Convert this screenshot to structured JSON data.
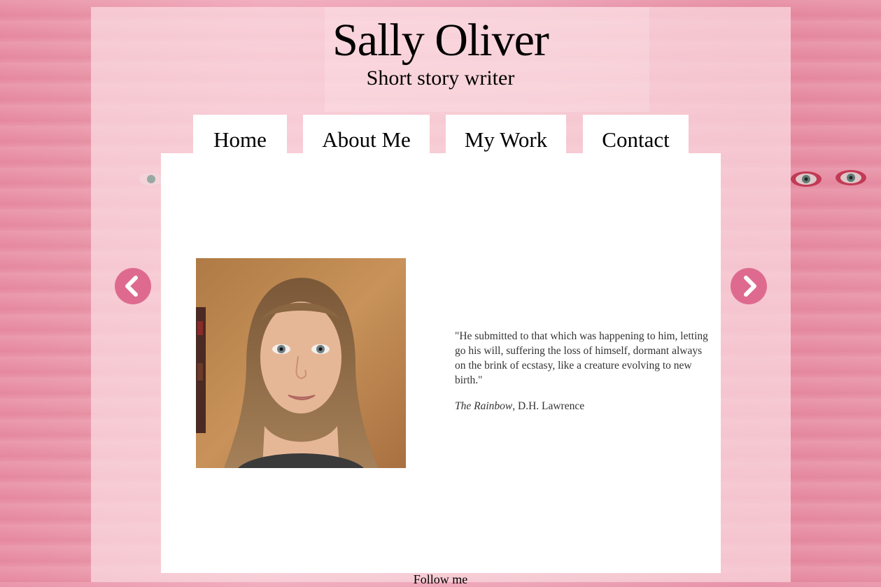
{
  "header": {
    "title": "Sally Oliver",
    "subtitle": "Short story writer"
  },
  "nav": {
    "tabs": [
      {
        "label": "Home"
      },
      {
        "label": "About Me"
      },
      {
        "label": "My Work"
      },
      {
        "label": "Contact"
      }
    ]
  },
  "slider": {
    "prev_icon": "chevron-left-icon",
    "next_icon": "chevron-right-icon",
    "accent_color": "#de6b8f"
  },
  "slide": {
    "image_alt": "Portrait photo",
    "quote": "\"He submitted to that which was happening to him, letting go his will, suffering the loss of himself, dormant always on the brink of ecstasy, like a creature evolving to new birth.\"",
    "source_title": "The Rainbow",
    "source_author": ", D.H. Lawrence"
  },
  "footer": {
    "follow_label": "Follow me"
  }
}
